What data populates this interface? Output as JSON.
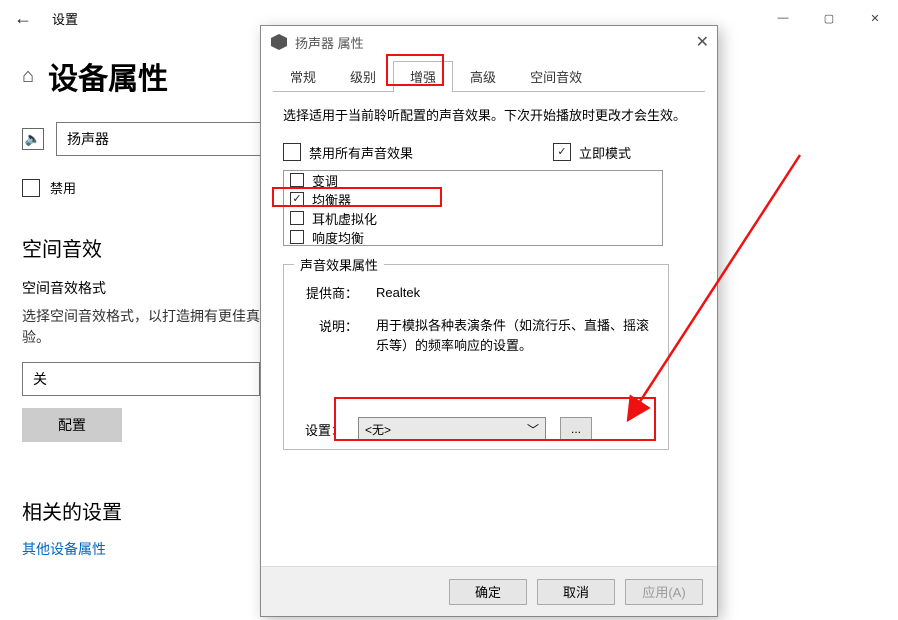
{
  "settings": {
    "window_title": "设置",
    "page_title": "设备属性",
    "device_name": "扬声器",
    "disable_label": "禁用",
    "spatial_heading": "空间音效",
    "spatial_format_label": "空间音效格式",
    "spatial_help": "选择空间音效格式，以打造拥有更佳真验。",
    "spatial_value": "关",
    "configure_label": "配置",
    "related_heading": "相关的设置",
    "related_link": "其他设备属性"
  },
  "dialog": {
    "title": "扬声器 属性",
    "tabs": {
      "general": "常规",
      "levels": "级别",
      "enhance": "增强",
      "advanced": "高级",
      "spatial": "空间音效"
    },
    "intro": "选择适用于当前聆听配置的声音效果。下次开始播放时更改才会生效。",
    "disable_all": "禁用所有声音效果",
    "immediate_mode": "立即模式",
    "effects": {
      "pitch": "变调",
      "equalizer": "均衡器",
      "hp_virtual": "耳机虚拟化",
      "loudness": "响度均衡"
    },
    "group_title": "声音效果属性",
    "provider_label": "提供商：",
    "provider_value": "Realtek",
    "desc_label": "说明：",
    "desc_value": "用于模拟各种表演条件（如流行乐、直播、摇滚乐等）的频率响应的设置。",
    "setting_label": "设置：",
    "setting_value": "<无>",
    "more_label": "...",
    "ok": "确定",
    "cancel": "取消",
    "apply": "应用(A)"
  }
}
